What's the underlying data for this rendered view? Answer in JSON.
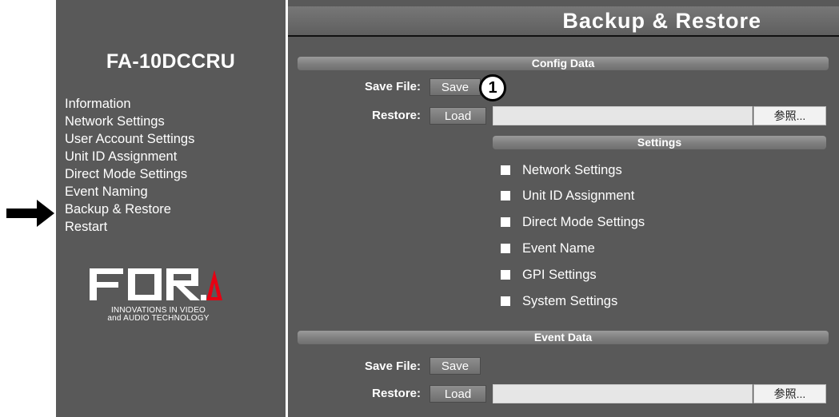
{
  "sidebar": {
    "model": "FA-10DCCRU",
    "nav": [
      "Information",
      "Network Settings",
      "User Account Settings",
      "Unit ID Assignment",
      "Direct Mode Settings",
      "Event Naming",
      "Backup & Restore",
      "Restart"
    ],
    "active_item": "Backup & Restore",
    "logo": {
      "brand": "FOR.A",
      "tagline_1": "INNOVATIONS IN VIDEO",
      "tagline_2": "and AUDIO TECHNOLOGY"
    }
  },
  "page": {
    "title": "Backup & Restore"
  },
  "config": {
    "header": "Config Data",
    "save_label": "Save File:",
    "save_button": "Save",
    "restore_label": "Restore:",
    "load_button": "Load",
    "browse_button": "参照...",
    "callout": "1",
    "settings_header": "Settings",
    "settings": [
      "Network Settings",
      "Unit ID Assignment",
      "Direct Mode Settings",
      "Event Name",
      "GPI Settings",
      "System Settings"
    ]
  },
  "event": {
    "header": "Event Data",
    "save_label": "Save File:",
    "save_button": "Save",
    "restore_label": "Restore:",
    "load_button": "Load",
    "browse_button": "参照..."
  },
  "colors": {
    "panel": "#595959",
    "bar": "#808080",
    "text": "#ffffff"
  }
}
